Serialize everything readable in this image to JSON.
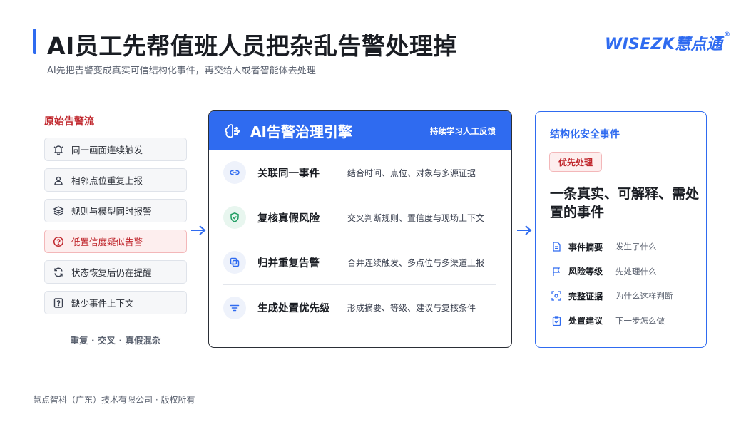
{
  "header": {
    "title": "AI员工先帮值班人员把杂乱告警处理掉",
    "subtitle": "AI先把告警变成真实可信结构化事件，再交给人或者智能体去处理",
    "brand": "WISEZK慧点通",
    "brand_mark": "®"
  },
  "left": {
    "title": "原始告警流",
    "items": [
      {
        "label": "同一画面连续触发",
        "icon": "bell-icon"
      },
      {
        "label": "相邻点位重复上报",
        "icon": "map-pin-user-icon"
      },
      {
        "label": "规则与模型同时报警",
        "icon": "layers-icon"
      },
      {
        "label": "低置信度疑似告警",
        "icon": "question-circle-icon"
      },
      {
        "label": "状态恢复后仍在提醒",
        "icon": "refresh-icon"
      },
      {
        "label": "缺少事件上下文",
        "icon": "question-square-icon"
      }
    ],
    "footer": "重复 · 交叉 · 真假混杂"
  },
  "engine": {
    "title": "AI告警治理引擎",
    "tag": "持续学习人工反馈",
    "steps": [
      {
        "title": "关联同一事件",
        "desc": "结合时间、点位、对象与多源证据",
        "icon": "link-icon"
      },
      {
        "title": "复核真假风险",
        "desc": "交叉判断规则、置信度与现场上下文",
        "icon": "shield-check-icon"
      },
      {
        "title": "归并重复告警",
        "desc": "合并连续触发、多点位与多渠道上报",
        "icon": "merge-icon"
      },
      {
        "title": "生成处置优先级",
        "desc": "形成摘要、等级、建议与复核条件",
        "icon": "filter-lines-icon"
      }
    ]
  },
  "result": {
    "title": "结构化安全事件",
    "badge": "优先处理",
    "headline": "一条真实、可解释、需处置的事件",
    "items": [
      {
        "label": "事件摘要",
        "desc": "发生了什么",
        "icon": "document-icon"
      },
      {
        "label": "风险等级",
        "desc": "先处理什么",
        "icon": "flag-icon"
      },
      {
        "label": "完整证据",
        "desc": "为什么这样判断",
        "icon": "scan-icon"
      },
      {
        "label": "处置建议",
        "desc": "下一步怎么做",
        "icon": "clipboard-check-icon"
      }
    ]
  },
  "footer": "慧点智科（广东）技术有限公司 · 版权所有",
  "colors": {
    "accent": "#2f6bf0",
    "alert": "#c0272d",
    "ok": "#1f9d62"
  }
}
